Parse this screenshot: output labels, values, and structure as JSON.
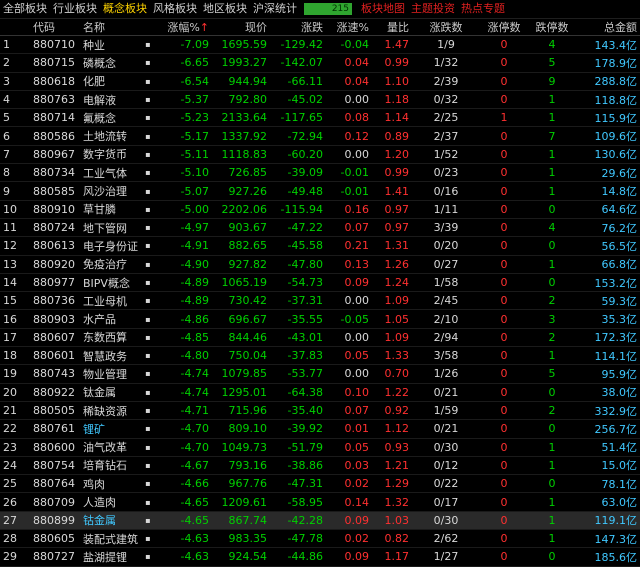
{
  "tabs": [
    {
      "label": "全部板块",
      "active": false,
      "style": "normal"
    },
    {
      "label": "行业板块",
      "active": false,
      "style": "normal"
    },
    {
      "label": "概念板块",
      "active": true,
      "style": "normal"
    },
    {
      "label": "风格板块",
      "active": false,
      "style": "normal"
    },
    {
      "label": "地区板块",
      "active": false,
      "style": "normal"
    },
    {
      "label": "沪深统计",
      "active": false,
      "style": "normal"
    }
  ],
  "count_value": "215",
  "links": [
    "板块地图",
    "主题投资",
    "热点专题"
  ],
  "headers": {
    "idx": "",
    "code": "代码",
    "name": "名称",
    "dot": "",
    "chg": "涨幅%",
    "arrow": "↑",
    "price": "现价",
    "diff": "涨跌",
    "speed": "涨速%",
    "vol": "量比",
    "updown": "涨跌数",
    "limitup": "涨停数",
    "limitdown": "跌停数",
    "cap": "总金额"
  },
  "colors": {
    "up": "#ff3030",
    "down": "#00d000",
    "active_tab": "#ffd400",
    "highlight_name": "#40c8ff"
  },
  "rows": [
    {
      "i": "1",
      "code": "880710",
      "name": "种业",
      "chg": "-7.09",
      "price": "1695.59",
      "diff": "-129.42",
      "speed": "-0.04",
      "vol": "1.47",
      "ud": "1/9",
      "lu": "0",
      "ld": "4",
      "cap": "143.4亿",
      "hl": false,
      "sel": false
    },
    {
      "i": "2",
      "code": "880715",
      "name": "磷概念",
      "chg": "-6.65",
      "price": "1993.27",
      "diff": "-142.07",
      "speed": "0.04",
      "vol": "0.99",
      "ud": "1/32",
      "lu": "0",
      "ld": "5",
      "cap": "178.9亿",
      "hl": false,
      "sel": false
    },
    {
      "i": "3",
      "code": "880618",
      "name": "化肥",
      "chg": "-6.54",
      "price": "944.94",
      "diff": "-66.11",
      "speed": "0.04",
      "vol": "1.10",
      "ud": "2/39",
      "lu": "0",
      "ld": "9",
      "cap": "288.8亿",
      "hl": false,
      "sel": false
    },
    {
      "i": "4",
      "code": "880763",
      "name": "电解液",
      "chg": "-5.37",
      "price": "792.80",
      "diff": "-45.02",
      "speed": "0.00",
      "vol": "1.18",
      "ud": "0/32",
      "lu": "0",
      "ld": "1",
      "cap": "118.8亿",
      "hl": false,
      "sel": false
    },
    {
      "i": "5",
      "code": "880714",
      "name": "氟概念",
      "chg": "-5.23",
      "price": "2133.64",
      "diff": "-117.65",
      "speed": "0.08",
      "vol": "1.14",
      "ud": "2/25",
      "lu": "1",
      "ld": "1",
      "cap": "115.9亿",
      "hl": false,
      "sel": false
    },
    {
      "i": "6",
      "code": "880586",
      "name": "土地流转",
      "chg": "-5.17",
      "price": "1337.92",
      "diff": "-72.94",
      "speed": "0.12",
      "vol": "0.89",
      "ud": "2/37",
      "lu": "0",
      "ld": "7",
      "cap": "109.6亿",
      "hl": false,
      "sel": false
    },
    {
      "i": "7",
      "code": "880967",
      "name": "数字货币",
      "chg": "-5.11",
      "price": "1118.83",
      "diff": "-60.20",
      "speed": "0.00",
      "vol": "1.20",
      "ud": "1/52",
      "lu": "0",
      "ld": "1",
      "cap": "130.6亿",
      "hl": false,
      "sel": false
    },
    {
      "i": "8",
      "code": "880734",
      "name": "工业气体",
      "chg": "-5.10",
      "price": "726.85",
      "diff": "-39.09",
      "speed": "-0.01",
      "vol": "0.99",
      "ud": "0/23",
      "lu": "0",
      "ld": "1",
      "cap": "29.6亿",
      "hl": false,
      "sel": false
    },
    {
      "i": "9",
      "code": "880585",
      "name": "风沙治理",
      "chg": "-5.07",
      "price": "927.26",
      "diff": "-49.48",
      "speed": "-0.01",
      "vol": "1.41",
      "ud": "0/16",
      "lu": "0",
      "ld": "1",
      "cap": "14.8亿",
      "hl": false,
      "sel": false
    },
    {
      "i": "10",
      "code": "880910",
      "name": "草甘膦",
      "chg": "-5.00",
      "price": "2202.06",
      "diff": "-115.94",
      "speed": "0.16",
      "vol": "0.97",
      "ud": "1/11",
      "lu": "0",
      "ld": "0",
      "cap": "64.6亿",
      "hl": false,
      "sel": false
    },
    {
      "i": "11",
      "code": "880724",
      "name": "地下管网",
      "chg": "-4.97",
      "price": "903.67",
      "diff": "-47.22",
      "speed": "0.07",
      "vol": "0.97",
      "ud": "3/39",
      "lu": "0",
      "ld": "4",
      "cap": "76.2亿",
      "hl": false,
      "sel": false
    },
    {
      "i": "12",
      "code": "880613",
      "name": "电子身份证",
      "chg": "-4.91",
      "price": "882.65",
      "diff": "-45.58",
      "speed": "0.21",
      "vol": "1.31",
      "ud": "0/20",
      "lu": "0",
      "ld": "0",
      "cap": "56.5亿",
      "hl": false,
      "sel": false
    },
    {
      "i": "13",
      "code": "880920",
      "name": "免疫治疗",
      "chg": "-4.90",
      "price": "927.82",
      "diff": "-47.80",
      "speed": "0.13",
      "vol": "1.26",
      "ud": "0/27",
      "lu": "0",
      "ld": "1",
      "cap": "66.8亿",
      "hl": false,
      "sel": false
    },
    {
      "i": "14",
      "code": "880977",
      "name": "BIPV概念",
      "chg": "-4.89",
      "price": "1065.19",
      "diff": "-54.73",
      "speed": "0.09",
      "vol": "1.24",
      "ud": "1/58",
      "lu": "0",
      "ld": "0",
      "cap": "153.2亿",
      "hl": false,
      "sel": false
    },
    {
      "i": "15",
      "code": "880736",
      "name": "工业母机",
      "chg": "-4.89",
      "price": "730.42",
      "diff": "-37.31",
      "speed": "0.00",
      "vol": "1.09",
      "ud": "2/45",
      "lu": "0",
      "ld": "2",
      "cap": "59.3亿",
      "hl": false,
      "sel": false
    },
    {
      "i": "16",
      "code": "880903",
      "name": "水产品",
      "chg": "-4.86",
      "price": "696.67",
      "diff": "-35.55",
      "speed": "-0.05",
      "vol": "1.05",
      "ud": "2/10",
      "lu": "0",
      "ld": "3",
      "cap": "35.3亿",
      "hl": false,
      "sel": false
    },
    {
      "i": "17",
      "code": "880607",
      "name": "东数西算",
      "chg": "-4.85",
      "price": "844.46",
      "diff": "-43.01",
      "speed": "0.00",
      "vol": "1.09",
      "ud": "2/94",
      "lu": "0",
      "ld": "2",
      "cap": "172.3亿",
      "hl": false,
      "sel": false
    },
    {
      "i": "18",
      "code": "880601",
      "name": "智慧政务",
      "chg": "-4.80",
      "price": "750.04",
      "diff": "-37.83",
      "speed": "0.05",
      "vol": "1.33",
      "ud": "3/58",
      "lu": "0",
      "ld": "1",
      "cap": "114.1亿",
      "hl": false,
      "sel": false
    },
    {
      "i": "19",
      "code": "880743",
      "name": "物业管理",
      "chg": "-4.74",
      "price": "1079.85",
      "diff": "-53.77",
      "speed": "0.00",
      "vol": "0.70",
      "ud": "1/26",
      "lu": "0",
      "ld": "5",
      "cap": "95.9亿",
      "hl": false,
      "sel": false
    },
    {
      "i": "20",
      "code": "880922",
      "name": "钛金属",
      "chg": "-4.74",
      "price": "1295.01",
      "diff": "-64.38",
      "speed": "0.10",
      "vol": "1.22",
      "ud": "0/21",
      "lu": "0",
      "ld": "0",
      "cap": "38.0亿",
      "hl": false,
      "sel": false
    },
    {
      "i": "21",
      "code": "880505",
      "name": "稀缺资源",
      "chg": "-4.71",
      "price": "715.96",
      "diff": "-35.40",
      "speed": "0.07",
      "vol": "0.92",
      "ud": "1/59",
      "lu": "0",
      "ld": "2",
      "cap": "332.9亿",
      "hl": false,
      "sel": false
    },
    {
      "i": "22",
      "code": "880761",
      "name": "锂矿",
      "chg": "-4.70",
      "price": "809.10",
      "diff": "-39.92",
      "speed": "0.01",
      "vol": "1.12",
      "ud": "0/21",
      "lu": "0",
      "ld": "0",
      "cap": "256.7亿",
      "hl": true,
      "sel": false
    },
    {
      "i": "23",
      "code": "880600",
      "name": "油气改革",
      "chg": "-4.70",
      "price": "1049.73",
      "diff": "-51.79",
      "speed": "0.05",
      "vol": "0.93",
      "ud": "0/30",
      "lu": "0",
      "ld": "1",
      "cap": "51.4亿",
      "hl": false,
      "sel": false
    },
    {
      "i": "24",
      "code": "880754",
      "name": "培育钻石",
      "chg": "-4.67",
      "price": "793.16",
      "diff": "-38.86",
      "speed": "0.03",
      "vol": "1.21",
      "ud": "0/12",
      "lu": "0",
      "ld": "1",
      "cap": "15.0亿",
      "hl": false,
      "sel": false
    },
    {
      "i": "25",
      "code": "880764",
      "name": "鸡肉",
      "chg": "-4.66",
      "price": "967.76",
      "diff": "-47.31",
      "speed": "0.02",
      "vol": "1.29",
      "ud": "0/22",
      "lu": "0",
      "ld": "0",
      "cap": "78.1亿",
      "hl": false,
      "sel": false
    },
    {
      "i": "26",
      "code": "880709",
      "name": "人造肉",
      "chg": "-4.65",
      "price": "1209.61",
      "diff": "-58.95",
      "speed": "0.14",
      "vol": "1.32",
      "ud": "0/17",
      "lu": "0",
      "ld": "1",
      "cap": "63.0亿",
      "hl": false,
      "sel": false
    },
    {
      "i": "27",
      "code": "880899",
      "name": "钴金属",
      "chg": "-4.65",
      "price": "867.74",
      "diff": "-42.28",
      "speed": "0.09",
      "vol": "1.03",
      "ud": "0/30",
      "lu": "0",
      "ld": "1",
      "cap": "119.1亿",
      "hl": true,
      "sel": true
    },
    {
      "i": "28",
      "code": "880605",
      "name": "装配式建筑",
      "chg": "-4.63",
      "price": "983.35",
      "diff": "-47.78",
      "speed": "0.02",
      "vol": "0.82",
      "ud": "2/62",
      "lu": "0",
      "ld": "1",
      "cap": "147.3亿",
      "hl": false,
      "sel": false
    },
    {
      "i": "29",
      "code": "880727",
      "name": "盐湖提锂",
      "chg": "-4.63",
      "price": "924.54",
      "diff": "-44.86",
      "speed": "0.09",
      "vol": "1.17",
      "ud": "1/27",
      "lu": "0",
      "ld": "0",
      "cap": "185.6亿",
      "hl": false,
      "sel": false
    }
  ]
}
